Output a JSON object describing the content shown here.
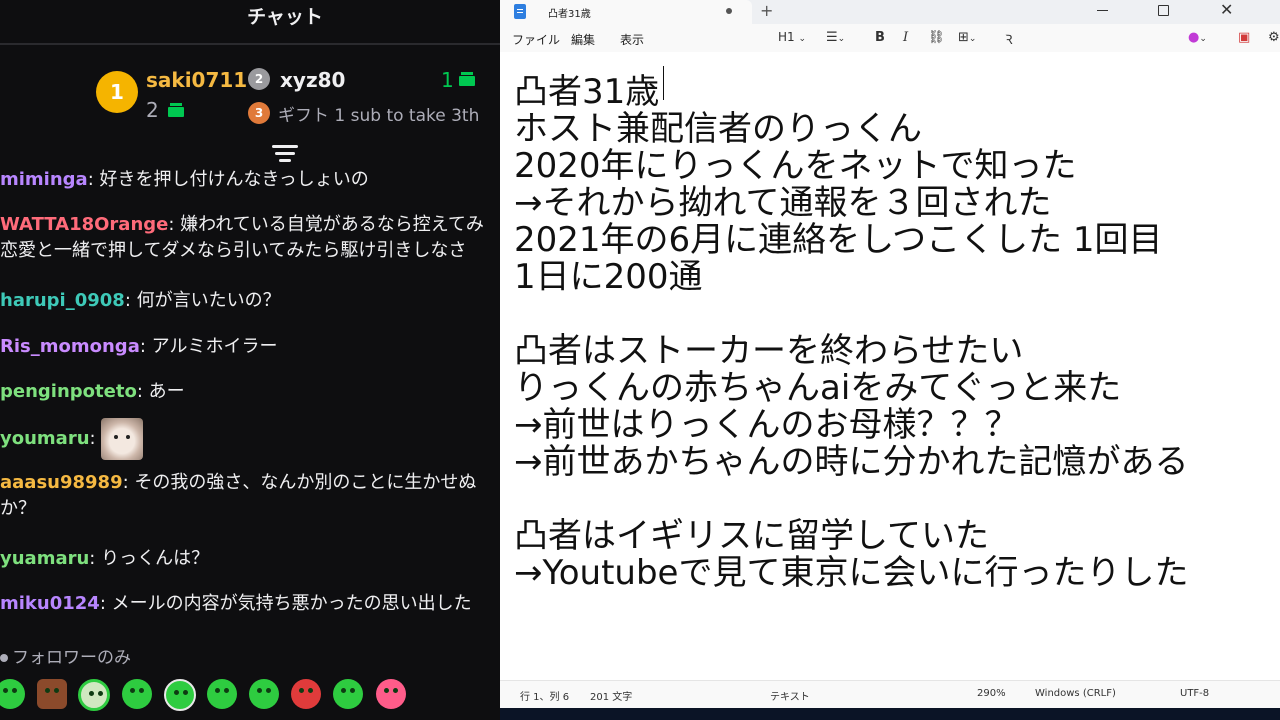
{
  "chat": {
    "title": "チャット",
    "leaderboard": {
      "first": {
        "rank": "1",
        "name": "saki0711",
        "count": "2"
      },
      "second": {
        "rank": "2",
        "name": "xyz80",
        "count": "1"
      },
      "third": {
        "rank": "3",
        "label": "ギフト 1 sub to take 3th"
      }
    },
    "messages": [
      {
        "user": "miminga",
        "color": "#b886ff",
        "text": "好きを押し付けんなきっしょいの"
      },
      {
        "user": "WATTA18Orange",
        "color": "#ff6b7a",
        "text": "嫌われている自覚があるなら控えてみ",
        "text2": "恋愛と一緒で押してダメなら引いてみたら駆け引きしなさ"
      },
      {
        "user": "harupi_0908",
        "color": "#3ec9b8",
        "text": "何が言いたいの？"
      },
      {
        "user": "Ris_momonga",
        "color": "#c98bff",
        "text": "アルミホイラー"
      },
      {
        "user": "penginpoteto",
        "color": "#7ee07e",
        "text": "あー"
      },
      {
        "user": "youmaru",
        "color": "#7ee07e",
        "text": ""
      },
      {
        "user": "aaasu98989",
        "color": "#f5b942",
        "text": "その我の強さ、なんか別のことに生かせぬ",
        "text2": "か？"
      },
      {
        "user": "yuamaru",
        "color": "#7ee07e",
        "text": "りっくんは？"
      },
      {
        "user": "miku0124",
        "color": "#b886ff",
        "text": "メールの内容が気持ち悪かったの思い出した"
      }
    ],
    "follower_mode": "フォロワーのみ"
  },
  "notepad": {
    "tab_title": "凸者31歳",
    "menus": [
      "ファイル",
      "編集",
      "表示"
    ],
    "toolbar": {
      "heading": "H1"
    },
    "lines": [
      "凸者31歳",
      "ホスト兼配信者のりっくん",
      "2020年にりっくんをネットで知った",
      "→それから拗れて通報を３回された",
      "2021年の6月に連絡をしつこくした 1回目",
      "1日に200通",
      "",
      "凸者はストーカーを終わらせたい",
      "りっくんの赤ちゃんaiをみてぐっと来た",
      "→前世はりっくんのお母様？？？",
      "→前世あかちゃんの時に分かれた記憶がある",
      "",
      "凸者はイギリスに留学していた",
      "→Youtubeで見て東京に会いに行ったりした"
    ],
    "status": {
      "position": "行 1、列 6",
      "chars": "201 文字",
      "format": "テキスト",
      "zoom": "290%",
      "line_ending": "Windows (CRLF)",
      "encoding": "UTF-8"
    }
  }
}
